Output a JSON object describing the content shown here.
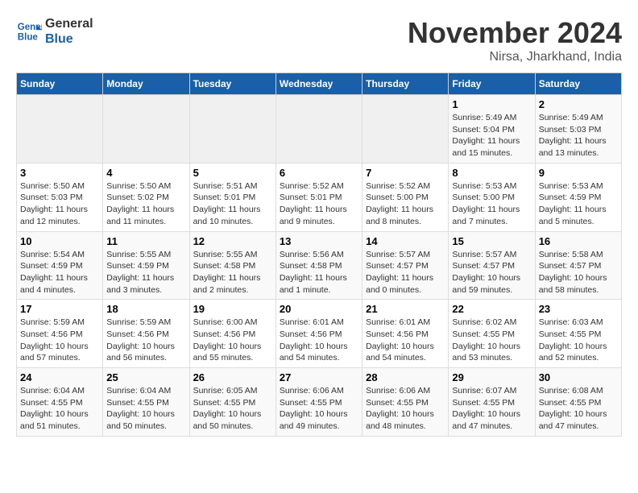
{
  "header": {
    "logo_line1": "General",
    "logo_line2": "Blue",
    "month": "November 2024",
    "location": "Nirsa, Jharkhand, India"
  },
  "weekdays": [
    "Sunday",
    "Monday",
    "Tuesday",
    "Wednesday",
    "Thursday",
    "Friday",
    "Saturday"
  ],
  "weeks": [
    [
      {
        "day": "",
        "info": ""
      },
      {
        "day": "",
        "info": ""
      },
      {
        "day": "",
        "info": ""
      },
      {
        "day": "",
        "info": ""
      },
      {
        "day": "",
        "info": ""
      },
      {
        "day": "1",
        "info": "Sunrise: 5:49 AM\nSunset: 5:04 PM\nDaylight: 11 hours and 15 minutes."
      },
      {
        "day": "2",
        "info": "Sunrise: 5:49 AM\nSunset: 5:03 PM\nDaylight: 11 hours and 13 minutes."
      }
    ],
    [
      {
        "day": "3",
        "info": "Sunrise: 5:50 AM\nSunset: 5:03 PM\nDaylight: 11 hours and 12 minutes."
      },
      {
        "day": "4",
        "info": "Sunrise: 5:50 AM\nSunset: 5:02 PM\nDaylight: 11 hours and 11 minutes."
      },
      {
        "day": "5",
        "info": "Sunrise: 5:51 AM\nSunset: 5:01 PM\nDaylight: 11 hours and 10 minutes."
      },
      {
        "day": "6",
        "info": "Sunrise: 5:52 AM\nSunset: 5:01 PM\nDaylight: 11 hours and 9 minutes."
      },
      {
        "day": "7",
        "info": "Sunrise: 5:52 AM\nSunset: 5:00 PM\nDaylight: 11 hours and 8 minutes."
      },
      {
        "day": "8",
        "info": "Sunrise: 5:53 AM\nSunset: 5:00 PM\nDaylight: 11 hours and 7 minutes."
      },
      {
        "day": "9",
        "info": "Sunrise: 5:53 AM\nSunset: 4:59 PM\nDaylight: 11 hours and 5 minutes."
      }
    ],
    [
      {
        "day": "10",
        "info": "Sunrise: 5:54 AM\nSunset: 4:59 PM\nDaylight: 11 hours and 4 minutes."
      },
      {
        "day": "11",
        "info": "Sunrise: 5:55 AM\nSunset: 4:59 PM\nDaylight: 11 hours and 3 minutes."
      },
      {
        "day": "12",
        "info": "Sunrise: 5:55 AM\nSunset: 4:58 PM\nDaylight: 11 hours and 2 minutes."
      },
      {
        "day": "13",
        "info": "Sunrise: 5:56 AM\nSunset: 4:58 PM\nDaylight: 11 hours and 1 minute."
      },
      {
        "day": "14",
        "info": "Sunrise: 5:57 AM\nSunset: 4:57 PM\nDaylight: 11 hours and 0 minutes."
      },
      {
        "day": "15",
        "info": "Sunrise: 5:57 AM\nSunset: 4:57 PM\nDaylight: 10 hours and 59 minutes."
      },
      {
        "day": "16",
        "info": "Sunrise: 5:58 AM\nSunset: 4:57 PM\nDaylight: 10 hours and 58 minutes."
      }
    ],
    [
      {
        "day": "17",
        "info": "Sunrise: 5:59 AM\nSunset: 4:56 PM\nDaylight: 10 hours and 57 minutes."
      },
      {
        "day": "18",
        "info": "Sunrise: 5:59 AM\nSunset: 4:56 PM\nDaylight: 10 hours and 56 minutes."
      },
      {
        "day": "19",
        "info": "Sunrise: 6:00 AM\nSunset: 4:56 PM\nDaylight: 10 hours and 55 minutes."
      },
      {
        "day": "20",
        "info": "Sunrise: 6:01 AM\nSunset: 4:56 PM\nDaylight: 10 hours and 54 minutes."
      },
      {
        "day": "21",
        "info": "Sunrise: 6:01 AM\nSunset: 4:56 PM\nDaylight: 10 hours and 54 minutes."
      },
      {
        "day": "22",
        "info": "Sunrise: 6:02 AM\nSunset: 4:55 PM\nDaylight: 10 hours and 53 minutes."
      },
      {
        "day": "23",
        "info": "Sunrise: 6:03 AM\nSunset: 4:55 PM\nDaylight: 10 hours and 52 minutes."
      }
    ],
    [
      {
        "day": "24",
        "info": "Sunrise: 6:04 AM\nSunset: 4:55 PM\nDaylight: 10 hours and 51 minutes."
      },
      {
        "day": "25",
        "info": "Sunrise: 6:04 AM\nSunset: 4:55 PM\nDaylight: 10 hours and 50 minutes."
      },
      {
        "day": "26",
        "info": "Sunrise: 6:05 AM\nSunset: 4:55 PM\nDaylight: 10 hours and 50 minutes."
      },
      {
        "day": "27",
        "info": "Sunrise: 6:06 AM\nSunset: 4:55 PM\nDaylight: 10 hours and 49 minutes."
      },
      {
        "day": "28",
        "info": "Sunrise: 6:06 AM\nSunset: 4:55 PM\nDaylight: 10 hours and 48 minutes."
      },
      {
        "day": "29",
        "info": "Sunrise: 6:07 AM\nSunset: 4:55 PM\nDaylight: 10 hours and 47 minutes."
      },
      {
        "day": "30",
        "info": "Sunrise: 6:08 AM\nSunset: 4:55 PM\nDaylight: 10 hours and 47 minutes."
      }
    ]
  ]
}
